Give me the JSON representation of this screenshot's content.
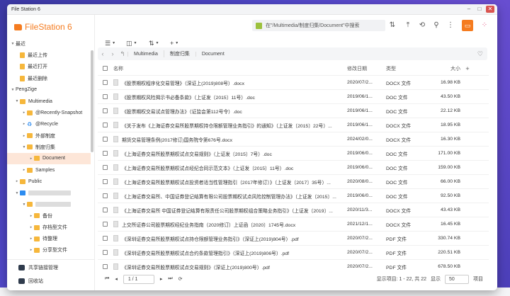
{
  "window": {
    "title": "File Station 6"
  },
  "brand": {
    "name": "FileStation 6"
  },
  "sidebar": {
    "recent_header": "最近",
    "recent_items": [
      "最近上传",
      "最近打开",
      "最近删除"
    ],
    "user_header": "PengZige",
    "tree": [
      {
        "label": "Multimedia",
        "level": 1
      },
      {
        "label": "@Recently-Snapshot",
        "level": 2
      },
      {
        "label": "@Recycle",
        "level": 2
      },
      {
        "label": "外部制度",
        "level": 2
      },
      {
        "label": "制度归集",
        "level": 2
      },
      {
        "label": "Document",
        "level": 3,
        "selected": true
      },
      {
        "label": "Samples",
        "level": 2
      },
      {
        "label": "Public",
        "level": 1
      },
      {
        "label": "",
        "level": 1
      },
      {
        "label": "",
        "level": 2
      },
      {
        "label": "备份",
        "level": 3
      },
      {
        "label": "存档型文件",
        "level": 3
      },
      {
        "label": "待整理",
        "level": 3
      },
      {
        "label": "分享型文件",
        "level": 3
      }
    ],
    "footer": [
      "共享链接管理",
      "回收站"
    ]
  },
  "search": {
    "placeholder": "在\"/Multimedia/制度归集/Document\"中搜索"
  },
  "path": {
    "segments": [
      "Multimedia",
      "制度归集",
      "Document"
    ]
  },
  "table": {
    "headers": {
      "name": "名称",
      "date": "修改日期",
      "type": "类型",
      "size": "大小"
    },
    "rows": [
      {
        "name": "《股票期权程序化交易管理》（深证上(2019)808号）.docx",
        "date": "2020/07/2...",
        "type": "DOCX 文件",
        "size": "16.98 KB"
      },
      {
        "name": "《股票期权风险揭示书必备条款》（上证发〔2015〕11号）.doc",
        "date": "2019/06/1...",
        "type": "DOC 文件",
        "size": "43.50 KB"
      },
      {
        "name": "《股票期权交易试点管理办法》（证监会第112号令）.doc",
        "date": "2019/06/1...",
        "type": "DOC 文件",
        "size": "22.12 KB"
      },
      {
        "name": "《关于发布《上海证券交易所股票期权持仓限额管理业务指引》的通知》（上证发〔2015〕22号）...",
        "date": "2019/06/1...",
        "type": "DOCX 文件",
        "size": "18.95 KB"
      },
      {
        "name": "期货交易管理条例(2017修订)国务院令第676号.docx",
        "date": "2024/02/0...",
        "type": "DOCX 文件",
        "size": "16.30 KB"
      },
      {
        "name": "《上海证券交易所股票期权试点交易规则》（上证发〔2015〕7号）.doc",
        "date": "2019/06/0...",
        "type": "DOC 文件",
        "size": "171.00 KB"
      },
      {
        "name": "《上海证券交易所股票期权试点经纪合同示范文本》（上证发〔2015〕11号）.doc",
        "date": "2019/06/0...",
        "type": "DOC 文件",
        "size": "159.00 KB"
      },
      {
        "name": "《上海证券交易所股票期权试点投资者适当性管理指引（2017年修订）》（上证发〔2017〕35号）...",
        "date": "2020/08/0...",
        "type": "DOC 文件",
        "size": "66.00 KB"
      },
      {
        "name": "《上海证券交易所、中国证券登记结算有限公司股票期权试点风险控制管理办法》（上证发〔2015〕...",
        "date": "2019/06/0...",
        "type": "DOC 文件",
        "size": "92.50 KB"
      },
      {
        "name": "《上海证券交易所 中国证券登记结算有限责任公司股票期权组合策略业务指引》（上证发〔2019〕...",
        "date": "2020/11/3...",
        "type": "DOCX 文件",
        "size": "43.43 KB"
      },
      {
        "name": "上交所证券公司股票期权经纪业务指南（2020修订）上证函〔2020〕1745号.docx",
        "date": "2021/12/1...",
        "type": "DOCX 文件",
        "size": "16.45 KB"
      },
      {
        "name": "《深圳证券交易所股票期权试点持仓限额管理业务指引》（深证上(2019)804号）.pdf",
        "date": "2020/07/2...",
        "type": "PDF 文件",
        "size": "330.74 KB"
      },
      {
        "name": "《深圳证券交易所股票期权试点合约条款管理指引》（深证上(2019)806号）.pdf",
        "date": "2020/07/2...",
        "type": "PDF 文件",
        "size": "220.51 KB"
      },
      {
        "name": "《深圳证券交易所股票期权试点交易规则》（深证上(2019)800号）.pdf",
        "date": "2020/07/2...",
        "type": "PDF 文件",
        "size": "678.50 KB"
      }
    ]
  },
  "footer": {
    "page": "1 / 1",
    "display": "显示项目: 1 - 22, 共 22",
    "show_label": "显示",
    "per_page": "50",
    "items_label": "项目"
  }
}
